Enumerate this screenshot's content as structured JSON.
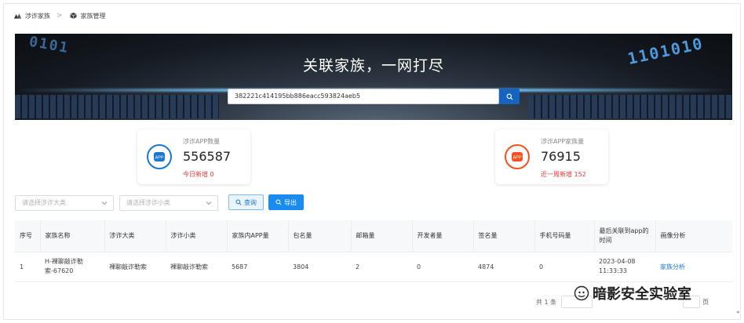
{
  "breadcrumb": {
    "items": [
      "涉诈家族",
      "家族管理"
    ],
    "separator": ">"
  },
  "banner": {
    "title": "关联家族，一网打尽",
    "search_value": "382221c414195bb886eacc593824aeb5",
    "digits_right": "1101010",
    "digits_left": "0101"
  },
  "stats": [
    {
      "label": "涉诈APP数量",
      "value": "556587",
      "sub": "今日新增 0",
      "icon": "app-icon",
      "color": "#1976d2"
    },
    {
      "label": "涉诈APP家族量",
      "value": "76915",
      "sub": "近一周新增 152",
      "icon": "app-family-icon",
      "color": "#f4511e"
    }
  ],
  "filters": {
    "category_placeholder": "请选择涉诈大类",
    "subcategory_placeholder": "请选择涉诈小类",
    "query_label": "查询",
    "export_label": "导出"
  },
  "table": {
    "headers": [
      "序号",
      "家族名称",
      "涉诈大类",
      "涉诈小类",
      "家族内APP量",
      "包名量",
      "邮箱量",
      "开发者量",
      "签名量",
      "手机号码量",
      "最后关联到app的时间",
      "画像分析"
    ],
    "rows": [
      {
        "index": "1",
        "family_name": "H-裸聊敲诈勒索-67620",
        "category": "裸聊敲诈勒索",
        "subcategory": "裸聊敲诈勒索",
        "app_count": "5687",
        "package_count": "3804",
        "email_count": "2",
        "developer_count": "0",
        "signature_count": "4874",
        "phone_count": "0",
        "last_time": "2023-04-08 11:33:33",
        "action": "家族分析"
      }
    ]
  },
  "pagination": {
    "total": "共 1 条",
    "page_suffix": "页"
  },
  "watermark": {
    "text": "暗影安全实验室"
  },
  "colors": {
    "primary": "#1a8cf0",
    "accent_blue": "#1976d2",
    "accent_orange": "#f4511e",
    "alert_red": "#e53935"
  }
}
